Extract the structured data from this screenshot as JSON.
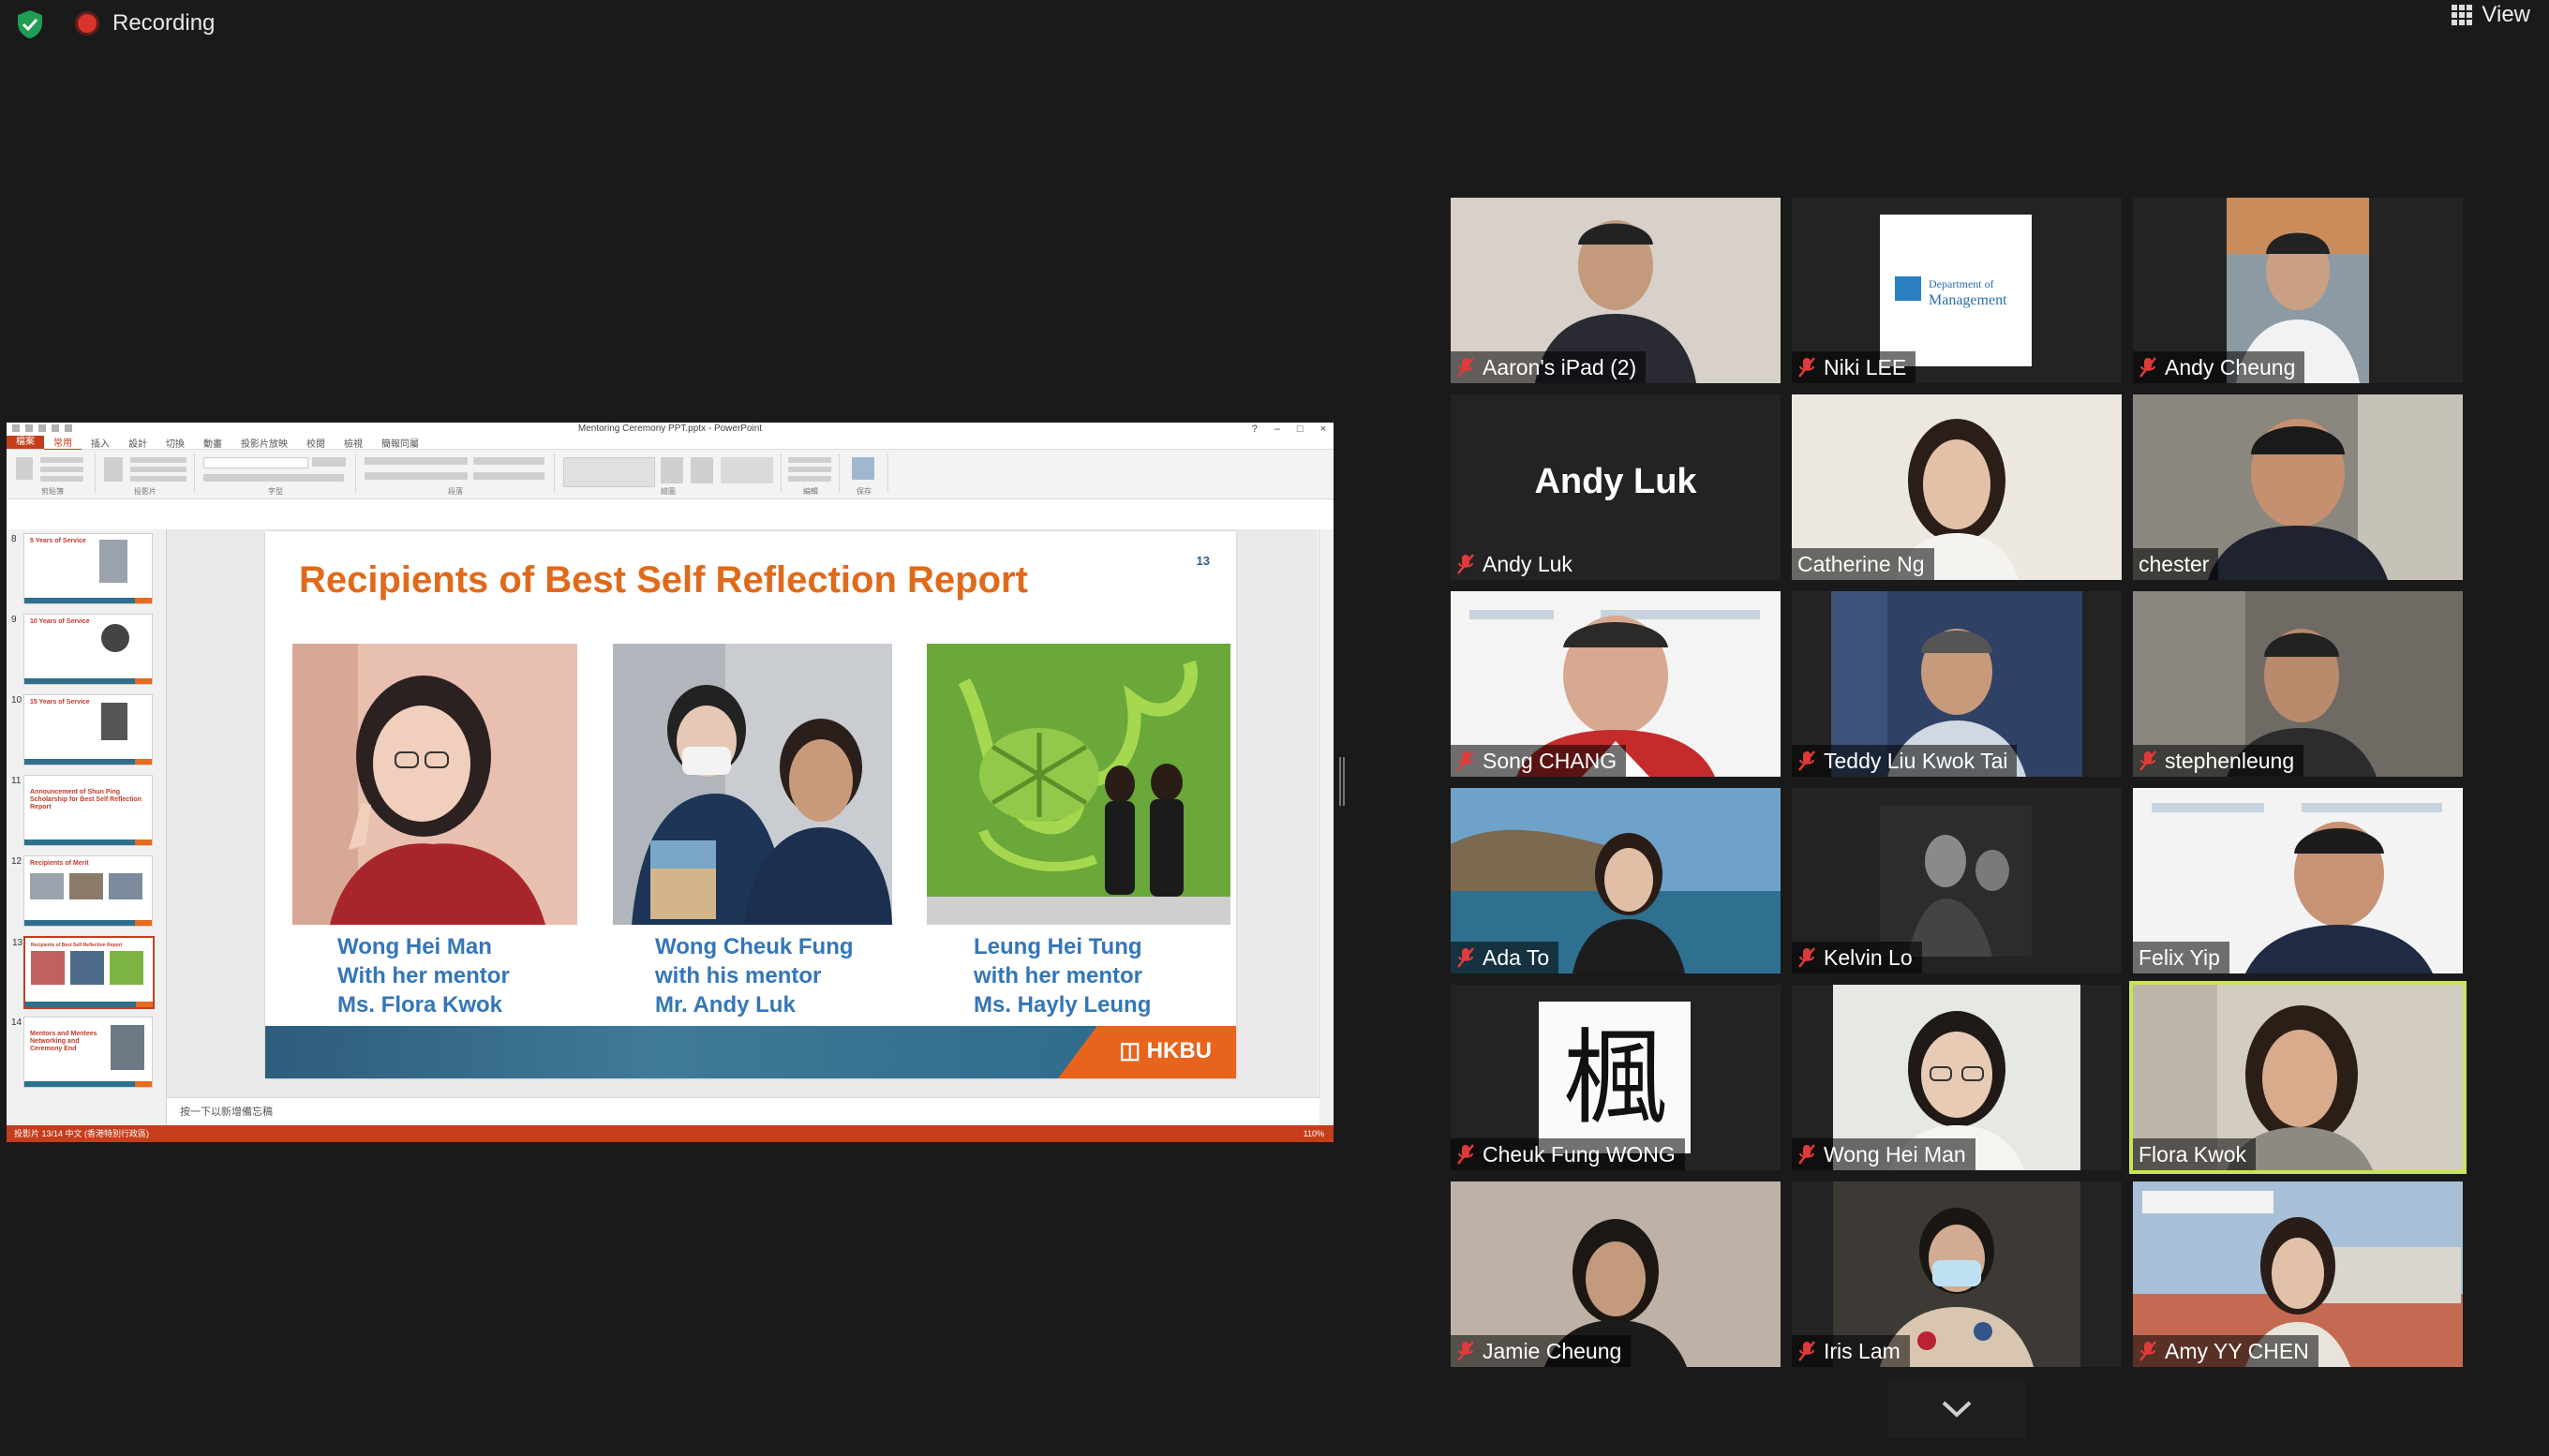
{
  "topbar": {
    "recording_label": "Recording",
    "view_label": "View"
  },
  "ppt": {
    "window_title": "Mentoring Ceremony PPT.pptx - PowerPoint",
    "tabs": [
      "檔案",
      "常用",
      "插入",
      "設計",
      "切換",
      "動畫",
      "投影片放映",
      "校閱",
      "檢視",
      "簡報同屬"
    ],
    "ribbon_groups": [
      "剪貼簿",
      "投影片",
      "字型",
      "段落",
      "繪圖",
      "編輯",
      "保存"
    ],
    "notes_placeholder": "按一下以新增備忘稿",
    "status_left": "投影片 13/14   中文 (香港特別行政區)",
    "status_right": "110%",
    "thumbnails": [
      {
        "num": "8",
        "title": "5 Years of Service"
      },
      {
        "num": "9",
        "title": "10 Years of Service"
      },
      {
        "num": "10",
        "title": "15 Years of Service"
      },
      {
        "num": "11",
        "title": "Announcement of Shun Ping Scholarship for Best Self Reflection Report"
      },
      {
        "num": "12",
        "title": "Recipients of Merit"
      },
      {
        "num": "13",
        "title": "Recipients of Best Self Reflection Report"
      },
      {
        "num": "14",
        "title": "Mentors and Mentees Networking and Ceremony End"
      }
    ],
    "slide": {
      "title": "Recipients of Best Self Reflection Report",
      "number": "13",
      "captions": [
        [
          "Wong Hei Man",
          "With her mentor",
          "Ms. Flora Kwok"
        ],
        [
          "Wong Cheuk Fung",
          "with his mentor",
          "Mr. Andy Luk"
        ],
        [
          "Leung Hei Tung",
          "with her mentor",
          "Ms. Hayly Leung"
        ]
      ],
      "logo_text": "HKBU"
    }
  },
  "participants": [
    {
      "name": "Aaron's iPad (2)",
      "muted": true
    },
    {
      "name": "Niki LEE",
      "muted": true
    },
    {
      "name": "Andy Cheung",
      "muted": true
    },
    {
      "name": "Andy Luk",
      "muted": true,
      "video_off": true
    },
    {
      "name": "Catherine Ng",
      "muted": false
    },
    {
      "name": "chester",
      "muted": false
    },
    {
      "name": "Song CHANG",
      "muted": true
    },
    {
      "name": "Teddy Liu Kwok Tai",
      "muted": true
    },
    {
      "name": "stephenleung",
      "muted": true
    },
    {
      "name": "Ada To",
      "muted": true
    },
    {
      "name": "Kelvin Lo",
      "muted": true
    },
    {
      "name": "Felix Yip",
      "muted": false
    },
    {
      "name": "Cheuk Fung WONG",
      "muted": true
    },
    {
      "name": "Wong Hei Man",
      "muted": true
    },
    {
      "name": "Flora Kwok",
      "muted": false,
      "speaking": true
    },
    {
      "name": "Jamie Cheung",
      "muted": true
    },
    {
      "name": "Iris Lam",
      "muted": true
    },
    {
      "name": "Amy YY CHEN",
      "muted": true
    }
  ],
  "colors": {
    "accent_orange": "#e06a1b",
    "caption_blue": "#3476b8",
    "speaker_outline": "#c9e35a",
    "ppt_red": "#c43e1c"
  }
}
